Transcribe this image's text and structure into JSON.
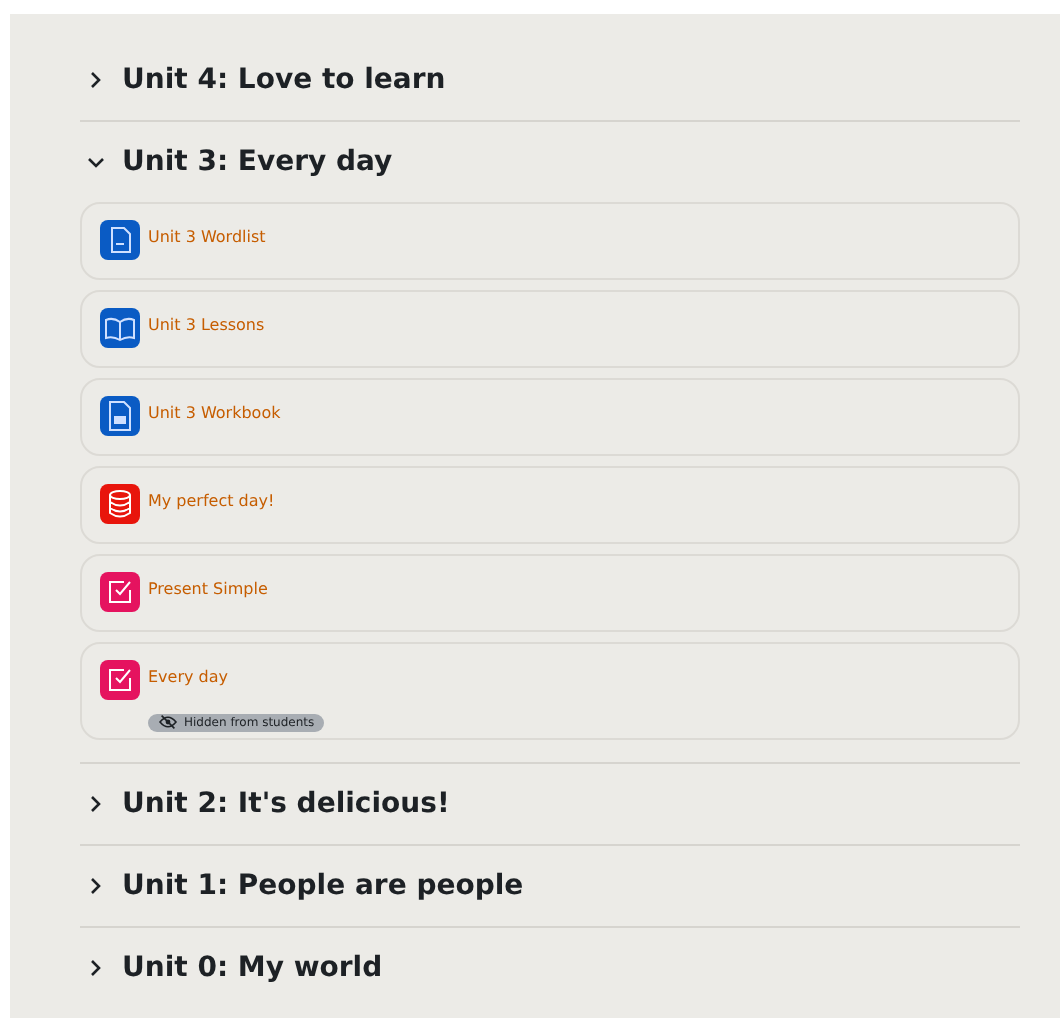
{
  "sections": [
    {
      "title": "Unit 4: Love to learn",
      "expanded": false
    },
    {
      "title": "Unit 3: Every day",
      "expanded": true,
      "activities": [
        {
          "name": "Unit 3 Wordlist",
          "kind": "file"
        },
        {
          "name": "Unit 3 Lessons",
          "kind": "book"
        },
        {
          "name": "Unit 3 Workbook",
          "kind": "page"
        },
        {
          "name": "My perfect day!",
          "kind": "database"
        },
        {
          "name": "Present Simple",
          "kind": "assignment"
        },
        {
          "name": "Every day",
          "kind": "assignment",
          "badge": "Hidden from students"
        }
      ]
    },
    {
      "title": "Unit 2: It's delicious!",
      "expanded": false
    },
    {
      "title": "Unit 1: People are people",
      "expanded": false
    },
    {
      "title": "Unit 0: My world",
      "expanded": false
    }
  ]
}
